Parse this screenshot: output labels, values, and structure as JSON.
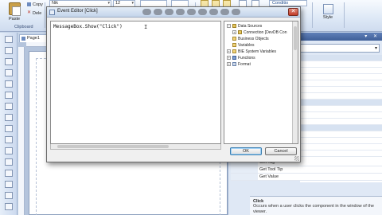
{
  "ribbon": {
    "paste_label": "Paste",
    "copy_label": "Copy",
    "delete_label": "Dele",
    "clipboard_group": "Clipboard",
    "font_name": "Nik",
    "font_size": "12",
    "condition_combo": "Conditio",
    "style_label": "Style"
  },
  "document": {
    "tab_label": "Page1"
  },
  "dialog": {
    "title": "Event Editor [Click]",
    "code": "MessageBox.Show(\"Click\")",
    "tree": [
      {
        "label": "Data Sources",
        "expander": "minus",
        "icon": "database-icon",
        "level": 0
      },
      {
        "label": "Connection [DevDB Con",
        "expander": "plus",
        "icon": "connection-icon",
        "level": 1
      },
      {
        "label": "Business Objects",
        "expander": "",
        "icon": "folder-icon",
        "level": 0
      },
      {
        "label": "Variables",
        "expander": "",
        "icon": "folder-icon",
        "level": 0
      },
      {
        "label": "BIE System Variables",
        "expander": "plus",
        "icon": "folder-icon",
        "level": 0
      },
      {
        "label": "Functions",
        "expander": "plus",
        "icon": "function-icon",
        "level": 0
      },
      {
        "label": "Format",
        "expander": "plus",
        "icon": "format-icon",
        "level": 0
      }
    ],
    "ok_label": "OK",
    "cancel_label": "Cancel"
  },
  "properties": {
    "events": [
      "Get Tag",
      "Get Tool Tip",
      "Get Value"
    ],
    "help_title": "Click",
    "help_desc": "Occurs when a user clicks the component in the window of the viewer."
  },
  "colors": {
    "ribbon": "#dde8f6",
    "panel_header": "#4f6fa8",
    "dialog_bg": "#f0f0f0",
    "close_button": "#c23c28"
  }
}
